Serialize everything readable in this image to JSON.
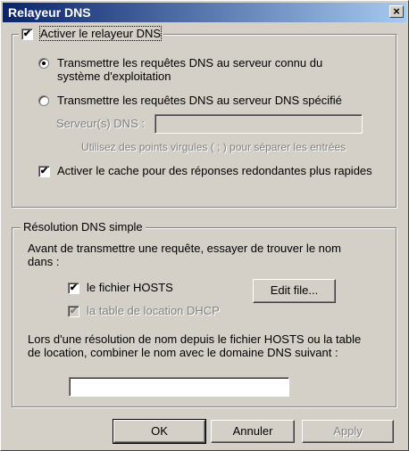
{
  "window": {
    "title": "Relayeur DNS",
    "close_symbol": "×"
  },
  "relay_group": {
    "enable_relay": {
      "label": "Activer le relayeur DNS",
      "checked": true
    },
    "option_os": {
      "label_line1": "Transmettre les requêtes DNS au serveur connu du",
      "label_line2": "système d'exploitation",
      "selected": true
    },
    "option_specified": {
      "label": "Transmettre les requêtes DNS au serveur DNS spécifié",
      "selected": false
    },
    "server_label": "Serveur(s) DNS :",
    "server_value": "",
    "hint": "Utilisez des points virgules ( ; ) pour séparer les entrées",
    "enable_cache": {
      "label": "Activer le cache pour des réponses redondantes plus rapides",
      "checked": true
    }
  },
  "simple_group": {
    "legend": "Résolution DNS simple",
    "intro_line1": "Avant de transmettre une requête, essayer de trouver le nom",
    "intro_line2": "dans :",
    "hosts": {
      "label": "le fichier HOSTS",
      "checked": true
    },
    "edit_button": "Edit file...",
    "dhcp": {
      "label": "la table de location DHCP",
      "checked": true
    },
    "combine_line1": "Lors d'une résolution de nom depuis le fichier HOSTS ou la table",
    "combine_line2": "de location, combiner le nom avec le domaine DNS suivant :",
    "domain_value": ""
  },
  "buttons": {
    "ok": "OK",
    "cancel": "Annuler",
    "apply": "Apply"
  },
  "colors": {
    "face": "#d4d0c8",
    "title_start": "#0a246a",
    "title_end": "#a6caf0",
    "disabled": "#808080"
  }
}
